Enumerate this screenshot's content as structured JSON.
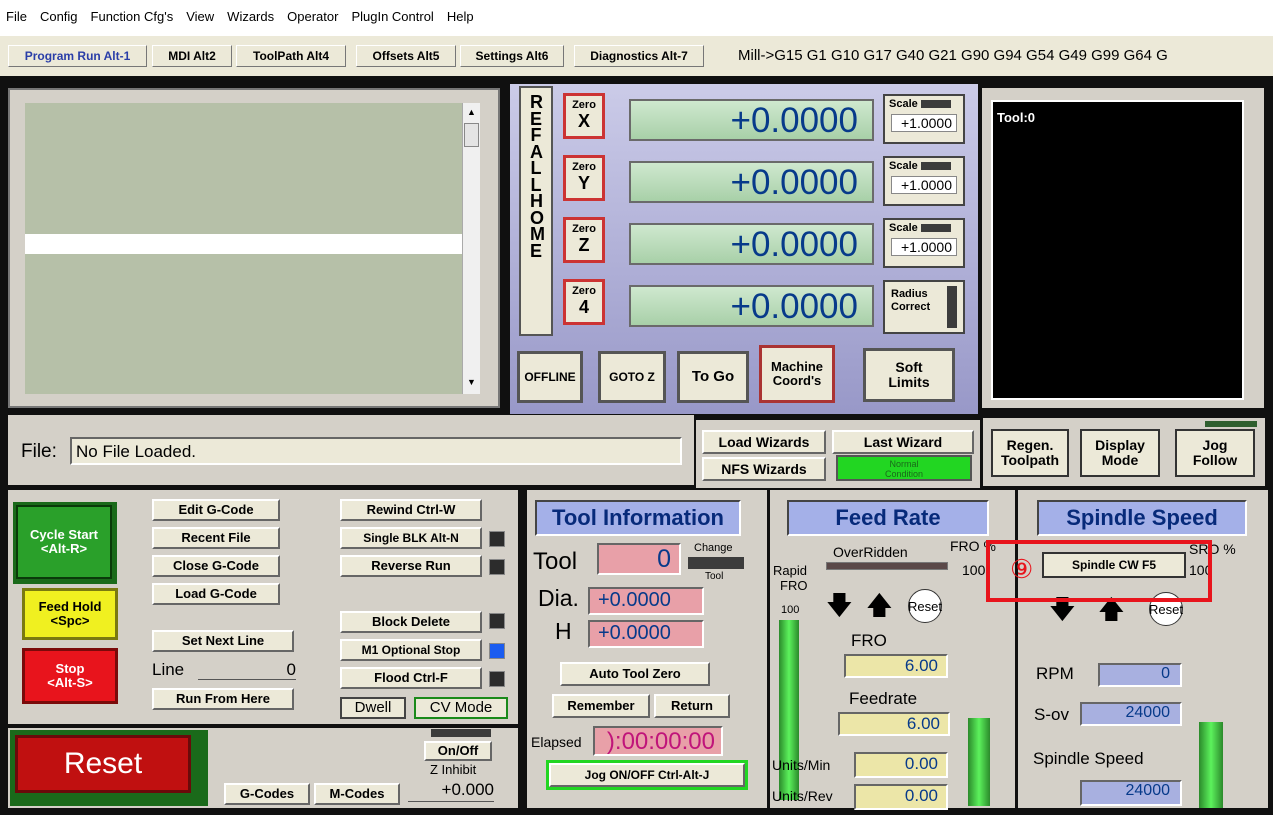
{
  "menu": [
    "File",
    "Config",
    "Function Cfg's",
    "View",
    "Wizards",
    "Operator",
    "PlugIn Control",
    "Help"
  ],
  "tabs": [
    "Program Run Alt-1",
    "MDI Alt2",
    "ToolPath Alt4",
    "Offsets Alt5",
    "Settings Alt6",
    "Diagnostics Alt-7"
  ],
  "modal_line": "Mill->G15  G1 G10 G17 G40 G21 G90 G94 G54 G49 G99 G64 G",
  "ref_all_home": "REF ALL HOME",
  "axes": [
    {
      "zero_top": "Zero",
      "zero_letter": "X",
      "value": "+0.0000",
      "scale_label": "Scale",
      "scale_value": "+1.0000"
    },
    {
      "zero_top": "Zero",
      "zero_letter": "Y",
      "value": "+0.0000",
      "scale_label": "Scale",
      "scale_value": "+1.0000"
    },
    {
      "zero_top": "Zero",
      "zero_letter": "Z",
      "value": "+0.0000",
      "scale_label": "Scale",
      "scale_value": "+1.0000"
    },
    {
      "zero_top": "Zero",
      "zero_letter": "4",
      "value": "+0.0000",
      "radius1": "Radius",
      "radius2": "Correct"
    }
  ],
  "dro_buttons": {
    "offline": "OFFLINE",
    "gotoz": "GOTO Z",
    "togo": "To Go",
    "machine1": "Machine",
    "machine2": "Coord's",
    "soft1": "Soft",
    "soft2": "Limits"
  },
  "tool_display": "Tool:0",
  "file": {
    "label": "File:",
    "value": "No File Loaded."
  },
  "wizards": {
    "load": "Load Wizards",
    "last": "Last Wizard",
    "nfs": "NFS Wizards",
    "cond1": "Normal",
    "cond2": "Condition"
  },
  "view": {
    "regen1": "Regen.",
    "regen2": "Toolpath",
    "display1": "Display",
    "display2": "Mode",
    "jog1": "Jog",
    "jog2": "Follow"
  },
  "cycle": {
    "start1": "Cycle Start",
    "start2": "<Alt-R>",
    "hold1": "Feed Hold",
    "hold2": "<Spc>",
    "stop1": "Stop",
    "stop2": "<Alt-S>"
  },
  "program": {
    "edit": "Edit G-Code",
    "recent": "Recent File",
    "close": "Close G-Code",
    "load": "Load G-Code",
    "setnext": "Set Next Line",
    "line_label": "Line",
    "line_value": "0",
    "runfrom": "Run From Here"
  },
  "controls": {
    "rewind": "Rewind Ctrl-W",
    "single": "Single BLK Alt-N",
    "reverse": "Reverse Run",
    "blockdel": "Block Delete",
    "m1": "M1 Optional Stop",
    "flood": "Flood Ctrl-F",
    "dwell": "Dwell",
    "cvmode": "CV Mode"
  },
  "reset": {
    "label": "Reset",
    "gcodes": "G-Codes",
    "mcodes": "M-Codes",
    "onoff": "On/Off",
    "zinhibit": "Z Inhibit",
    "zvalue": "+0.000"
  },
  "toolinfo": {
    "title": "Tool Information",
    "tool_label": "Tool",
    "tool_value": "0",
    "change": "Change",
    "change_sub": "Tool",
    "dia_label": "Dia.",
    "dia_value": "+0.0000",
    "h_label": "H",
    "h_value": "+0.0000",
    "autozero": "Auto Tool Zero",
    "remember": "Remember",
    "return": "Return",
    "elapsed_label": "Elapsed",
    "elapsed_value": "):00:00:00",
    "jog": "Jog ON/OFF Ctrl-Alt-J"
  },
  "feed": {
    "title": "Feed Rate",
    "overridden": "OverRidden",
    "fro_pct": "FRO %",
    "fro_pct_val": "100",
    "rapid": "Rapid",
    "fro_small": "FRO",
    "rapid_val": "100",
    "reset": "Reset",
    "fro_label": "FRO",
    "fro_value": "6.00",
    "feedrate_label": "Feedrate",
    "feedrate_value": "6.00",
    "umin_label": "Units/Min",
    "umin_value": "0.00",
    "urev_label": "Units/Rev",
    "urev_value": "0.00"
  },
  "spindle": {
    "title": "Spindle Speed",
    "cw": "Spindle CW F5",
    "sro_pct": "SRO %",
    "sro_val": "100",
    "reset": "Reset",
    "rpm_label": "RPM",
    "rpm_value": "0",
    "sov_label": "S-ov",
    "sov_value": "24000",
    "speed_label": "Spindle Speed",
    "speed_value": "24000",
    "callout": "⑨"
  },
  "colors": {
    "accent_red": "#e8141c",
    "dro_text": "#073a8a",
    "panel": "#d4d0c8"
  }
}
